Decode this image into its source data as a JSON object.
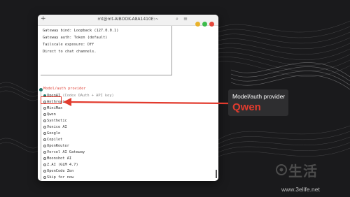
{
  "window": {
    "title": "mt@mt-AIBOOK-A8A1410E:~",
    "new_tab_glyph": "+",
    "header_icons": [
      "search-icon",
      "menu-icon"
    ],
    "controls": [
      {
        "name": "minimize",
        "color": "#e9b22b"
      },
      {
        "name": "maximize",
        "color": "#3cbb4b"
      },
      {
        "name": "close",
        "color": "#e5483c"
      }
    ]
  },
  "info_lines": [
    "Gateway bind: Loopback (127.0.0.1)",
    "Gateway auth: Token (default)",
    "Tailscale exposure: Off",
    "Direct to chat channels."
  ],
  "prompt": {
    "label": "Model/auth provider"
  },
  "options": [
    {
      "label": "OpenAI",
      "hint": "(Codex OAuth + API key)",
      "selected": true
    },
    {
      "label": "Anthropic",
      "selected": false
    },
    {
      "label": "MiniMax",
      "selected": false
    },
    {
      "label": "Qwen",
      "selected": false,
      "highlighted": true
    },
    {
      "label": "Synthetic",
      "selected": false
    },
    {
      "label": "Venice AI",
      "selected": false
    },
    {
      "label": "Google",
      "selected": false
    },
    {
      "label": "Copilot",
      "selected": false
    },
    {
      "label": "OpenRouter",
      "selected": false
    },
    {
      "label": "Vercel AI Gateway",
      "selected": false
    },
    {
      "label": "Moonshot AI",
      "selected": false
    },
    {
      "label": "Z.AI (GLM 4.7)",
      "selected": false
    },
    {
      "label": "OpenCode Zen",
      "selected": false
    },
    {
      "label": "Skip for now",
      "selected": false
    }
  ],
  "callout": {
    "title": "Model/auth provider",
    "highlight": "Qwen",
    "accent_color": "#e23b2e"
  },
  "watermark": {
    "brand_text": "生活",
    "url": "www.3elife.net"
  }
}
